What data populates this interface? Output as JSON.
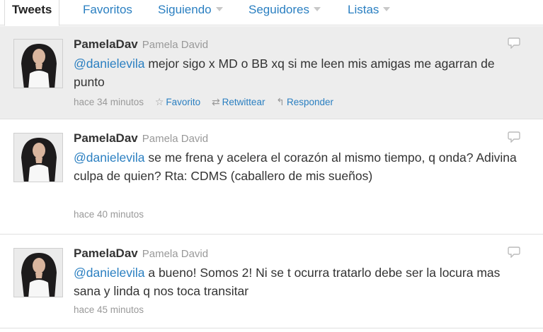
{
  "tabs": [
    {
      "label": "Tweets",
      "active": true
    },
    {
      "label": "Favoritos"
    },
    {
      "label": "Siguiendo"
    },
    {
      "label": "Seguidores"
    },
    {
      "label": "Listas"
    }
  ],
  "tweets": [
    {
      "screen_name": "PamelaDav",
      "full_name": "Pamela David",
      "mention": "@danielevila",
      "text": "mejor sigo x MD o BB xq si me leen mis amigas me agarran de punto",
      "time": "hace 34 minutos",
      "actions": {
        "favorite": "Favorito",
        "retweet": "Retwittear",
        "reply": "Responder"
      }
    },
    {
      "screen_name": "PamelaDav",
      "full_name": "Pamela David",
      "mention": "@danielevila",
      "text": "se me frena y acelera el corazón al mismo tiempo, q onda? Adivina culpa de quien? Rta: CDMS (caballero de mis sueños)",
      "time": "hace 40 minutos"
    },
    {
      "screen_name": "PamelaDav",
      "full_name": "Pamela David",
      "mention": "@danielevila",
      "text": "a bueno! Somos 2! Ni se t ocurra tratarlo debe ser la locura mas sana y linda q nos toca transitar",
      "time": "hace 45 minutos"
    }
  ],
  "colors": {
    "link": "#2a7fc1",
    "highlight_bg": "#ededed",
    "muted": "#999999"
  },
  "icons": [
    "star-icon",
    "retweet-icon",
    "reply-arrow-icon",
    "speech-bubble-icon",
    "caret-down-icon"
  ]
}
